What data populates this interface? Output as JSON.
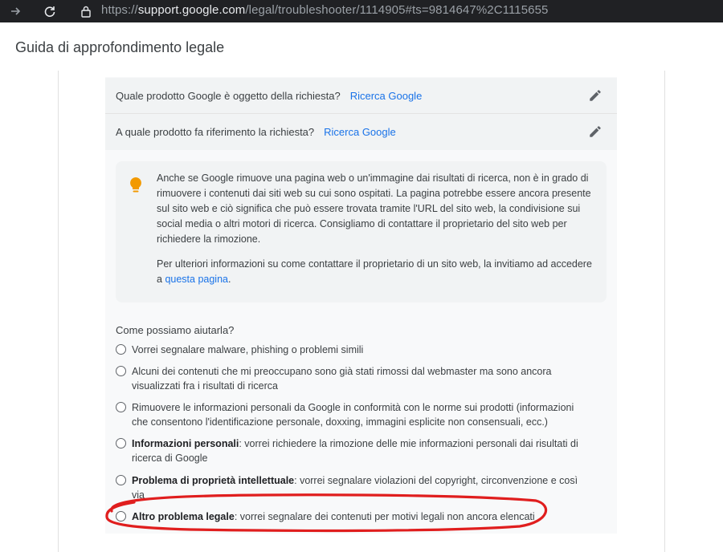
{
  "browser": {
    "url_prefix": "https://",
    "url_host": "support.google.com",
    "url_path": "/legal/troubleshooter/1114905#ts=9814647%2C1115655"
  },
  "header": {
    "title": "Guida di approfondimento legale"
  },
  "questions": [
    {
      "label": "Quale prodotto Google è oggetto della richiesta?",
      "answer": "Ricerca Google"
    },
    {
      "label": "A quale prodotto fa riferimento la richiesta?",
      "answer": "Ricerca Google"
    }
  ],
  "info": {
    "para1": "Anche se Google rimuove una pagina web o un'immagine dai risultati di ricerca, non è in grado di rimuovere i contenuti dai siti web su cui sono ospitati. La pagina potrebbe essere ancora presente sul sito web e ciò significa che può essere trovata tramite l'URL del sito web, la condivisione sui social media o altri motori di ricerca. Consigliamo di contattare il proprietario del sito web per richiedere la rimozione.",
    "para2_prefix": "Per ulteriori informazioni su come contattare il proprietario di un sito web, la invitiamo ad accedere a ",
    "para2_link": "questa pagina",
    "para2_suffix": "."
  },
  "help": {
    "question": "Come possiamo aiutarla?",
    "options": [
      {
        "bold": "",
        "text": "Vorrei segnalare malware, phishing o problemi simili"
      },
      {
        "bold": "",
        "text": "Alcuni dei contenuti che mi preoccupano sono già stati rimossi dal webmaster ma sono ancora visualizzati fra i risultati di ricerca"
      },
      {
        "bold": "",
        "text": "Rimuovere le informazioni personali da Google in conformità con le norme sui prodotti (informazioni che consentono l'identificazione personale, doxxing, immagini esplicite non consensuali, ecc.)"
      },
      {
        "bold": "Informazioni personali",
        "text": ": vorrei richiedere la rimozione delle mie informazioni personali dai risultati di ricerca di Google"
      },
      {
        "bold": "Problema di proprietà intellettuale",
        "text": ": vorrei segnalare violazioni del copyright, circonvenzione e così via"
      },
      {
        "bold": "Altro problema legale",
        "text": ": vorrei segnalare dei contenuti per motivi legali non ancora elencati"
      }
    ]
  },
  "colors": {
    "link": "#1a73e8",
    "bulb": "#f29900",
    "annotation": "#e01e1e"
  }
}
